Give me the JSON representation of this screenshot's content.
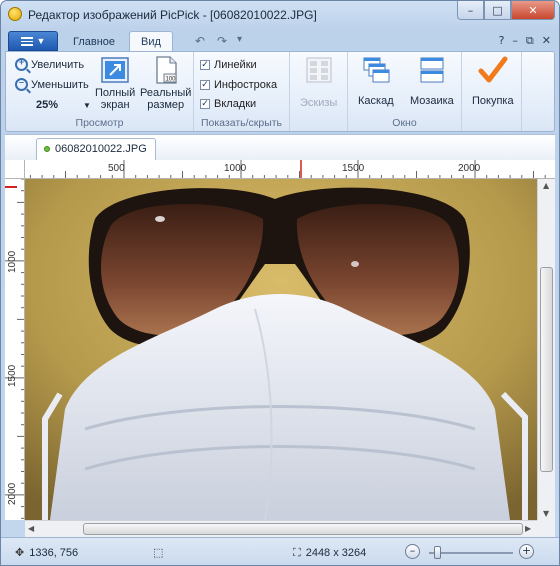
{
  "window": {
    "title": "Редактор изображений PicPick - [06082010022.JPG]",
    "caption_minimize": "–",
    "caption_maximize": "□",
    "caption_close": "✕"
  },
  "tabs": {
    "home": "Главное",
    "view": "Вид",
    "undo_icon": "↶",
    "redo_icon": "↷",
    "qa_dropdown": "▾"
  },
  "window_controls_small": {
    "help": "?",
    "minimize": "–",
    "restore": "⧉",
    "close": "✕"
  },
  "ribbon": {
    "view_group": {
      "zoom_in": "Увеличить",
      "zoom_out": "Уменьшить",
      "zoom_value": "25%",
      "fullscreen_line1": "Полный",
      "fullscreen_line2": "экран",
      "actual_line1": "Реальный",
      "actual_line2": "размер",
      "label": "Просмотр"
    },
    "show_group": {
      "rulers": "Линейки",
      "infobar": "Инфострока",
      "tabs": "Вкладки",
      "label": "Показать/скрыть",
      "checked": true
    },
    "thumbs_label": "Эскизы",
    "window_group": {
      "cascade": "Каскад",
      "tile": "Мозаика",
      "label": "Окно"
    },
    "buy_label": "Покупка"
  },
  "document_tab": {
    "label": "06082010022.JPG"
  },
  "ruler": {
    "top_ticks": [
      "500",
      "1000",
      "1500",
      "2000"
    ],
    "left_ticks": [
      "1000",
      "1500",
      "2000"
    ]
  },
  "status": {
    "cursor": "1336, 756",
    "image_size": "2448 x 3264",
    "zoom_percent": 25
  },
  "colors": {
    "accent": "#2b5fb4",
    "ruler_marker": "#d32020",
    "buy_check": "#f07a1c"
  },
  "icons": {
    "cursor": "crosshair-icon",
    "selection": "selection-icon",
    "size": "crop-size-icon",
    "zoom_minus": "zoom-out-icon",
    "zoom_plus": "zoom-in-icon"
  }
}
